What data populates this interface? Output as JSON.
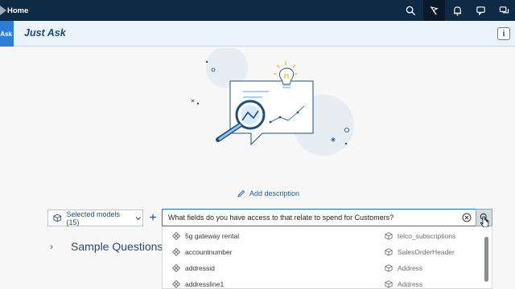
{
  "shell": {
    "title": "Home"
  },
  "header": {
    "badge": "Ask",
    "title": "Just Ask"
  },
  "add_description": "Add description",
  "models": {
    "label": "Selected models (15)"
  },
  "query": {
    "value": "What fields do you have access to that relate to spend for Customers?"
  },
  "sample_questions": "Sample Questions",
  "suggestions": [
    {
      "field": "5g gateway rental",
      "model": "telco_subscriptions"
    },
    {
      "field": "accountnumber",
      "model": "SalesOrderHeader"
    },
    {
      "field": "addressid",
      "model": "Address"
    },
    {
      "field": "addressline1",
      "model": "Address"
    }
  ],
  "colors": {
    "shellbar": "#0f2a45",
    "accent": "#2a7fd4",
    "header_bg": "#eaf2fb"
  },
  "icons": [
    "search-icon",
    "joule-icon",
    "bell-icon",
    "feedback-icon",
    "chat-icon",
    "info-icon",
    "pencil-icon",
    "cube-icon",
    "plus-icon",
    "clear-icon"
  ]
}
